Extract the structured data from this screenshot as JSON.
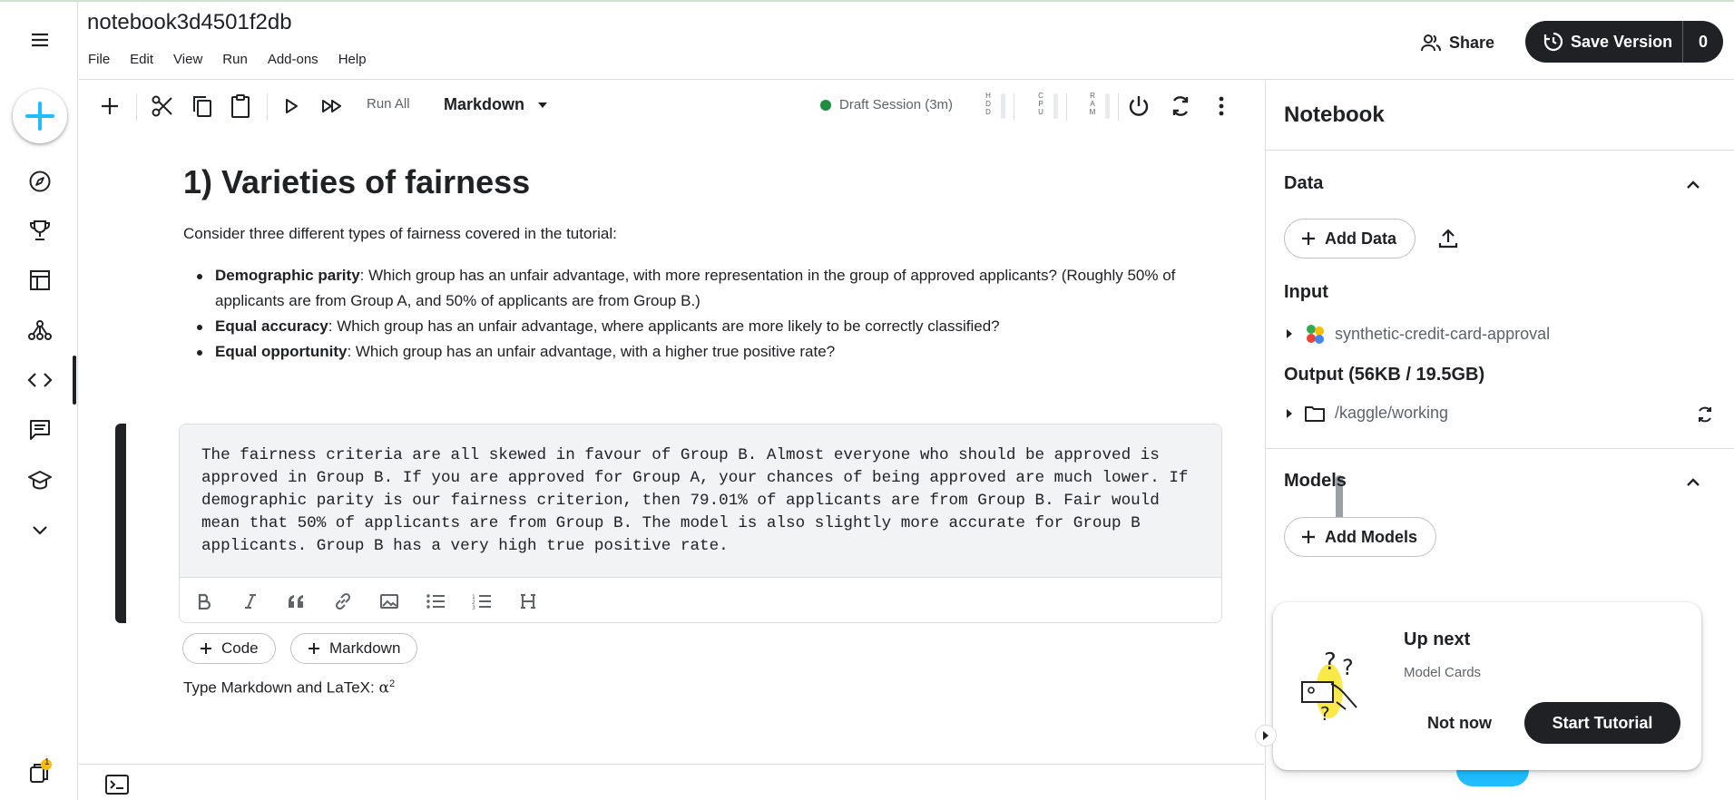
{
  "header": {
    "title": "notebook3d4501f2db",
    "menu": [
      "File",
      "Edit",
      "View",
      "Run",
      "Add-ons",
      "Help"
    ],
    "share_label": "Share",
    "save_label": "Save Version",
    "save_count": "0"
  },
  "rail": {
    "items": [
      "menu-icon",
      "create-icon",
      "compass-icon",
      "trophy-icon",
      "table-icon",
      "models-icon",
      "code-icon",
      "discussion-icon",
      "learn-icon",
      "more-icon"
    ],
    "notification_count": "1",
    "accent": "#20beff"
  },
  "toolbar": {
    "run_all": "Run All",
    "cell_type": "Markdown",
    "session": "Draft Session (3m)",
    "meters": [
      "HDD",
      "CPU",
      "RAM"
    ],
    "session_color": "#1e8e3e"
  },
  "cells": {
    "heading": "1) Varieties of fairness",
    "intro": "Consider three different types of fairness covered in the tutorial:",
    "items": [
      {
        "term": "Demographic parity",
        "text": ": Which group has an unfair advantage, with more representation in the group of approved applicants? (Roughly 50% of applicants are from Group A, and 50% of applicants are from Group B.)"
      },
      {
        "term": "Equal accuracy",
        "text": ": Which group has an unfair advantage, where applicants are more likely to be correctly classified?"
      },
      {
        "term": "Equal opportunity",
        "text": ": Which group has an unfair advantage, with a higher true positive rate?"
      }
    ],
    "editor_text": "The fairness criteria are all skewed in favour of Group B. Almost everyone who should be approved is\napproved in Group B. If you are approved for Group A, your chances of being approved are much lower. If\ndemographic parity is our fairness criterion, then 79.01% of applicants are from Group B. Fair would\nmean that 50% of applicants are from Group B. The model is also slightly more accurate for Group B\napplicants. Group B has a very high true positive rate.",
    "add_code": "Code",
    "add_markdown": "Markdown",
    "latex_hint": "Type Markdown and LaTeX: ",
    "latex_symbol": "α",
    "latex_exp": "2"
  },
  "panel": {
    "title": "Notebook",
    "data_title": "Data",
    "add_data": "Add Data",
    "input_title": "Input",
    "input_item": "synthetic-credit-card-approval",
    "output_title": "Output (56KB / 19.5GB)",
    "output_item": "/kaggle/working",
    "models_title": "Models",
    "add_models": "Add Models"
  },
  "upnext": {
    "title": "Up next",
    "subtitle": "Model Cards",
    "not_now": "Not now",
    "start": "Start Tutorial"
  }
}
